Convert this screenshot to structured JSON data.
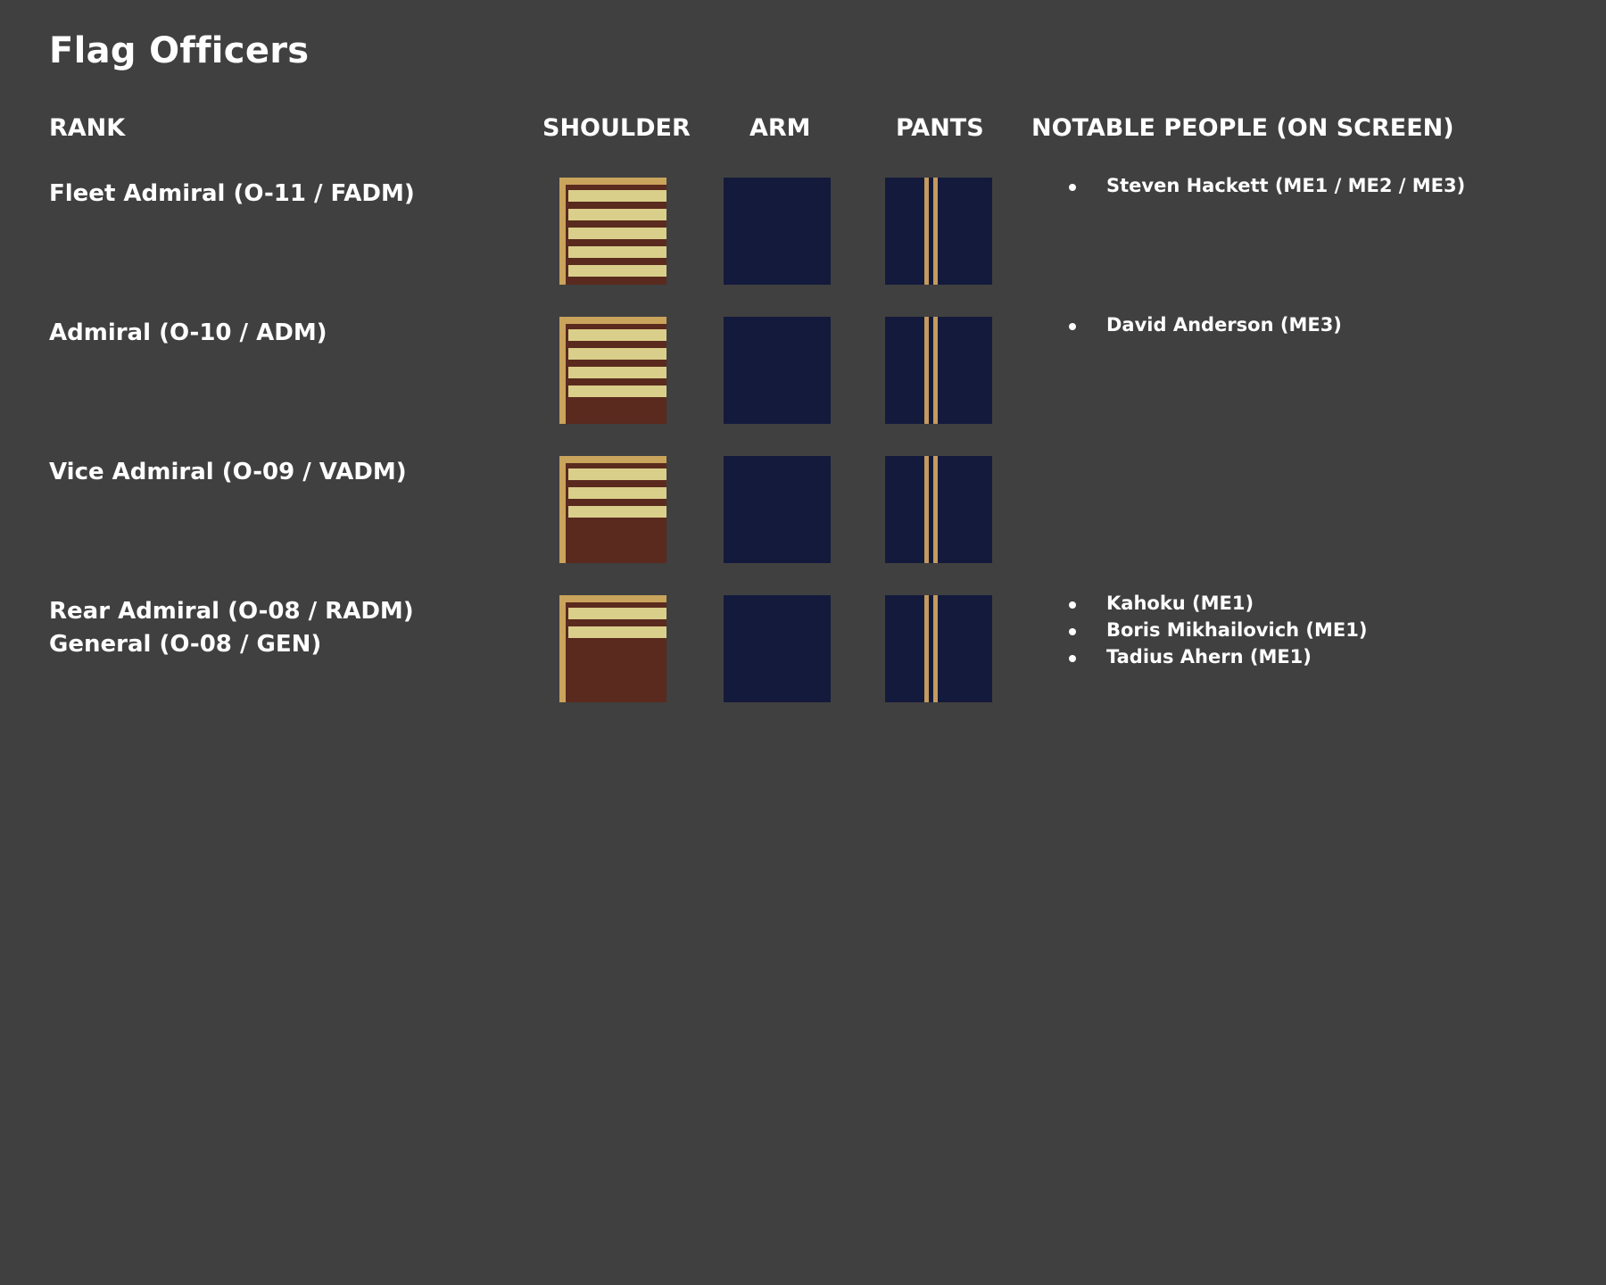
{
  "title": "Flag Officers",
  "headers": {
    "rank": "RANK",
    "shoulder": "SHOULDER",
    "arm": "ARM",
    "pants": "PANTS",
    "people": "NOTABLE PEOPLE (ON SCREEN)"
  },
  "colors": {
    "background": "#404040",
    "shoulder_base": "#5a2a1e",
    "gold": "#d9cf8a",
    "gold_edge": "#c9a45c",
    "navy": "#141a3c",
    "pants_stripe": "#c49a5e"
  },
  "rows": [
    {
      "rank_lines": [
        "Fleet Admiral (O-11 / FADM)"
      ],
      "shoulder_stripe_count": 5,
      "people": [
        "Steven Hackett (ME1 / ME2 / ME3)"
      ]
    },
    {
      "rank_lines": [
        "Admiral (O-10 / ADM)"
      ],
      "shoulder_stripe_count": 4,
      "people": [
        "David Anderson (ME3)"
      ]
    },
    {
      "rank_lines": [
        "Vice Admiral (O-09 / VADM)"
      ],
      "shoulder_stripe_count": 3,
      "people": []
    },
    {
      "rank_lines": [
        "Rear Admiral (O-08 / RADM)",
        "General (O-08 / GEN)"
      ],
      "shoulder_stripe_count": 2,
      "people": [
        "Kahoku (ME1)",
        "Boris Mikhailovich (ME1)",
        "Tadius Ahern (ME1)"
      ]
    }
  ]
}
